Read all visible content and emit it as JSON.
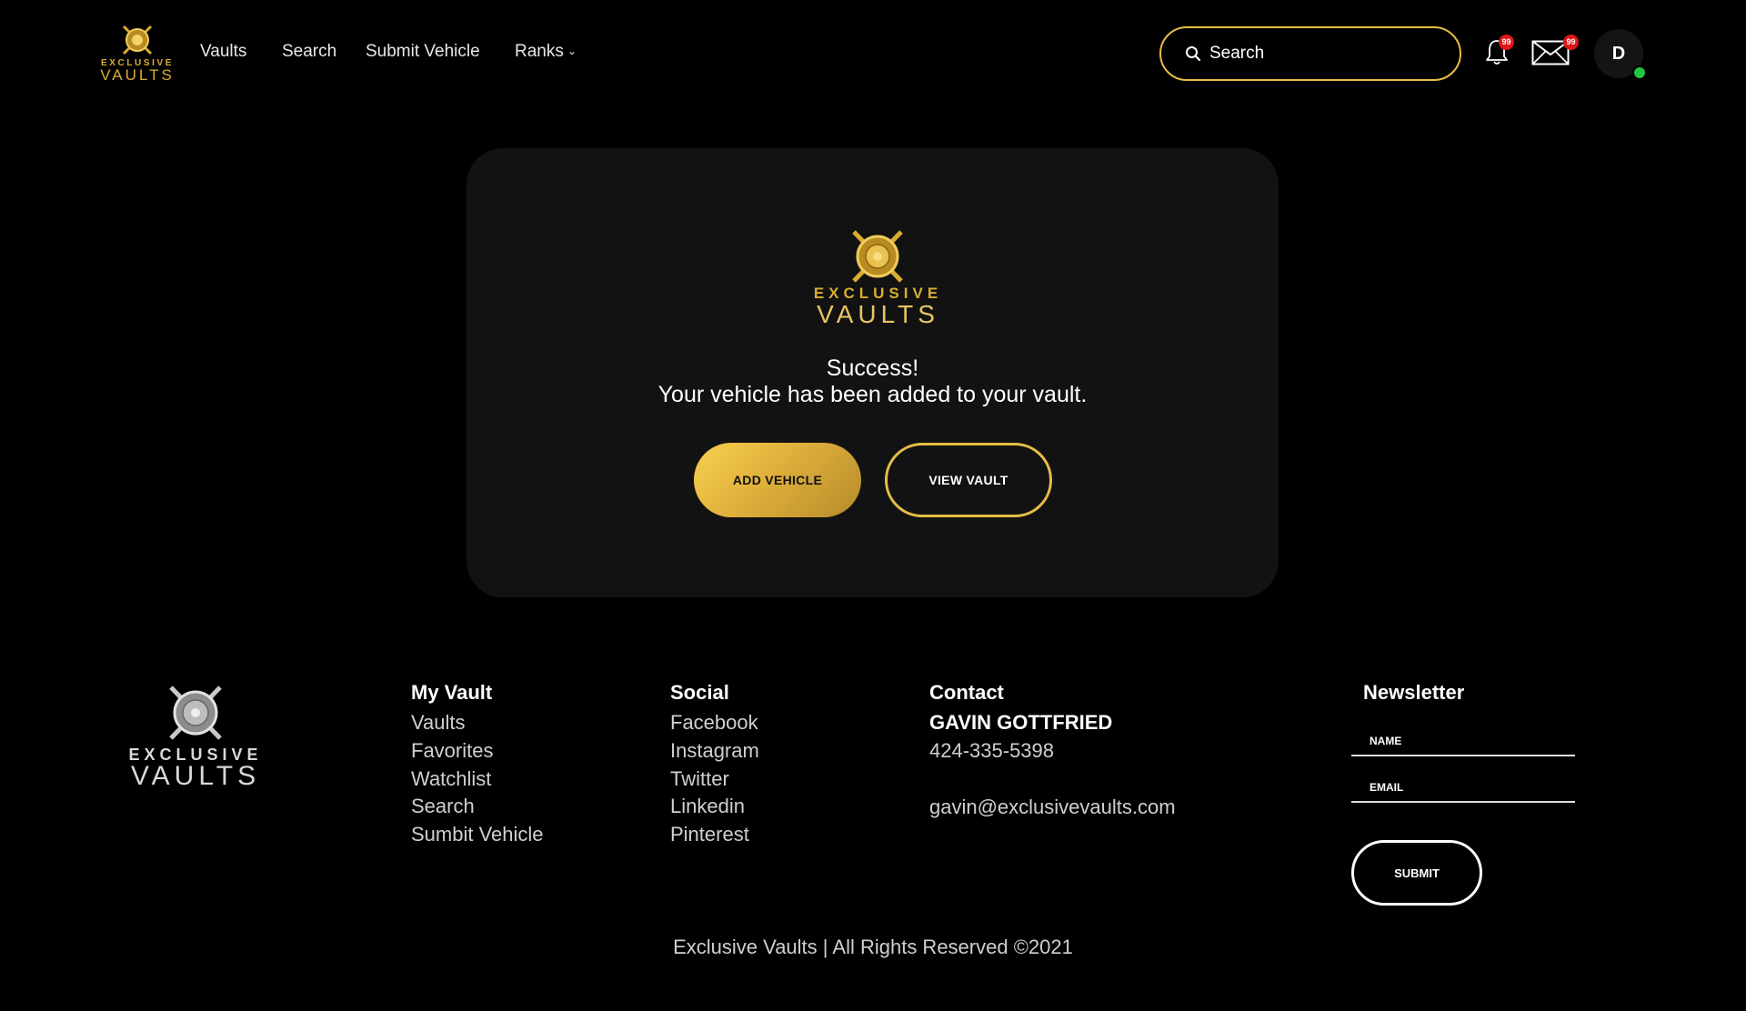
{
  "header": {
    "brand": {
      "word1": "EXCLUSIVE",
      "word2": "VAULTS"
    },
    "nav": [
      {
        "label": "Vaults"
      },
      {
        "label": "Search"
      },
      {
        "label": "Submit Vehicle"
      },
      {
        "label": "Ranks",
        "has_dropdown": true
      }
    ],
    "search_placeholder": "Search",
    "notifications": {
      "icon": "bell-icon",
      "badge": "99"
    },
    "messages": {
      "icon": "envelope-icon",
      "badge": "99"
    },
    "avatar": {
      "initial": "D",
      "status": "online"
    }
  },
  "card": {
    "brand": {
      "word1": "EXCLUSIVE",
      "word2": "VAULTS"
    },
    "title": "Success!",
    "message": "Your vehicle has been added to your vault.",
    "primary_button": "ADD VEHICLE",
    "secondary_button": "VIEW VAULT"
  },
  "footer": {
    "brand": {
      "word1": "EXCLUSIVE",
      "word2": "VAULTS"
    },
    "my_vault": {
      "heading": "My Vault",
      "links": [
        "Vaults",
        "Favorites",
        "Watchlist",
        "Search",
        "Sumbit Vehicle"
      ]
    },
    "social": {
      "heading": "Social",
      "links": [
        "Facebook",
        "Instagram",
        "Twitter",
        "Linkedin",
        "Pinterest"
      ]
    },
    "contact": {
      "heading": "Contact",
      "name": "GAVIN GOTTFRIED",
      "phone": "424-335-5398",
      "email": "gavin@exclusivevaults.com"
    },
    "newsletter": {
      "heading": "Newsletter",
      "name_placeholder": "NAME",
      "email_placeholder": "EMAIL",
      "submit": "SUBMIT"
    },
    "copyright": "Exclusive Vaults | All Rights Reserved ©2021"
  },
  "colors": {
    "background": "#000000",
    "card": "#121212",
    "gold": "#e6bd45",
    "badge": "#e01515",
    "online": "#22c443"
  }
}
